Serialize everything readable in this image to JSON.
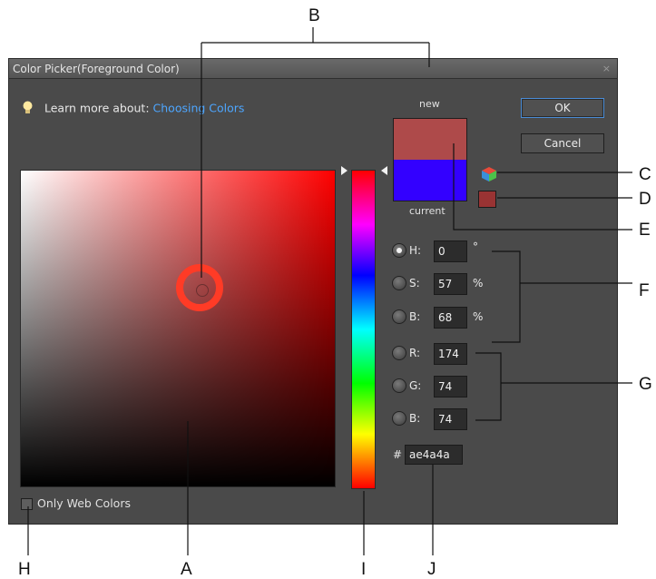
{
  "dialog": {
    "title": "Color Picker(Foreground Color)",
    "close_glyph": "×",
    "learn_prefix": "Learn more about:",
    "learn_link": "Choosing Colors",
    "new_label": "new",
    "current_label": "current",
    "ok_label": "OK",
    "cancel_label": "Cancel",
    "web_colors_label": "Only Web Colors",
    "web_colors_checked": false,
    "hex_prefix": "#",
    "hex_value": "ae4a4a"
  },
  "colors": {
    "new": "#ae4a4a",
    "current": "#3300ff",
    "websafe_swatch": "#993333",
    "selection_ring": "#ff3b26",
    "link": "#4da6ff",
    "field_hue": "#ff0000"
  },
  "hsb": [
    {
      "name": "H:",
      "value": "0",
      "unit": "°",
      "selected": true
    },
    {
      "name": "S:",
      "value": "57",
      "unit": "%",
      "selected": false
    },
    {
      "name": "B:",
      "value": "68",
      "unit": "%",
      "selected": false
    }
  ],
  "rgb": [
    {
      "name": "R:",
      "value": "174",
      "selected": false
    },
    {
      "name": "G:",
      "value": "74",
      "selected": false
    },
    {
      "name": "B:",
      "value": "74",
      "selected": false
    }
  ],
  "icons": {
    "bulb": "lightbulb-icon",
    "cube": "color-cube-icon",
    "close": "close-icon"
  },
  "callouts": {
    "B": "B",
    "C": "C",
    "D": "D",
    "E": "E",
    "F": "F",
    "G": "G",
    "H": "H",
    "A": "A",
    "I": "I",
    "J": "J"
  }
}
